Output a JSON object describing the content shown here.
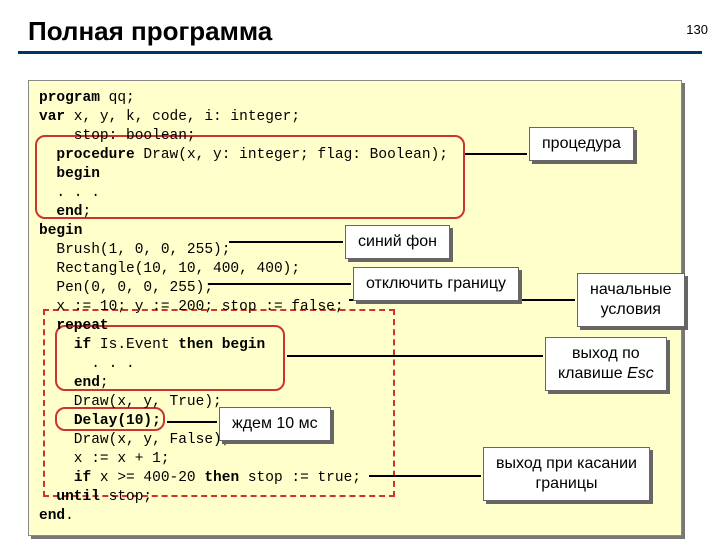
{
  "page_number": "130",
  "title": "Полная программа",
  "code_lines": [
    {
      "t": "program qq;",
      "bold_ranges": [
        [
          0,
          7
        ]
      ]
    },
    {
      "t": "var x, y, k, code, i: integer;",
      "bold_ranges": [
        [
          0,
          3
        ]
      ]
    },
    {
      "t": "    stop: boolean;",
      "bold_ranges": []
    },
    {
      "t": "  procedure Draw(x, y: integer; flag: Boolean);",
      "bold_ranges": [
        [
          2,
          11
        ]
      ]
    },
    {
      "t": "  begin",
      "bold_ranges": [
        [
          2,
          7
        ]
      ]
    },
    {
      "t": "  . . .",
      "bold_ranges": []
    },
    {
      "t": "  end;",
      "bold_ranges": [
        [
          2,
          5
        ]
      ]
    },
    {
      "t": "begin",
      "bold_ranges": [
        [
          0,
          5
        ]
      ]
    },
    {
      "t": "  Brush(1, 0, 0, 255);",
      "bold_ranges": []
    },
    {
      "t": "  Rectangle(10, 10, 400, 400);",
      "bold_ranges": []
    },
    {
      "t": "  Pen(0, 0, 0, 255);",
      "bold_ranges": []
    },
    {
      "t": "  x := 10; y := 200; stop := false;",
      "bold_ranges": []
    },
    {
      "t": "  repeat",
      "bold_ranges": [
        [
          2,
          8
        ]
      ]
    },
    {
      "t": "    if Is.Event then begin",
      "bold_ranges": [
        [
          4,
          6
        ],
        [
          16,
          20
        ],
        [
          21,
          26
        ]
      ]
    },
    {
      "t": "      . . .",
      "bold_ranges": []
    },
    {
      "t": "    end;",
      "bold_ranges": [
        [
          4,
          7
        ]
      ]
    },
    {
      "t": "    Draw(x, y, True);",
      "bold_ranges": []
    },
    {
      "t": "    Delay(10);",
      "bold_ranges": [
        [
          4,
          14
        ]
      ]
    },
    {
      "t": "    Draw(x, y, False);",
      "bold_ranges": []
    },
    {
      "t": "    x := x + 1;",
      "bold_ranges": []
    },
    {
      "t": "    if x >= 400-20 then stop := true;",
      "bold_ranges": [
        [
          4,
          6
        ],
        [
          19,
          23
        ]
      ]
    },
    {
      "t": "  until stop;",
      "bold_ranges": [
        [
          2,
          7
        ]
      ]
    },
    {
      "t": "end.",
      "bold_ranges": [
        [
          0,
          3
        ]
      ]
    }
  ],
  "callouts": {
    "procedure": "процедура",
    "blue_bg": "синий фон",
    "disable_border": "отключить границу",
    "initial_cond_l1": "начальные",
    "initial_cond_l2": "условия",
    "exit_esc_l1": "выход по",
    "exit_esc_l2_a": "клавише ",
    "exit_esc_l2_b": "Esc",
    "wait": "ждем 10 мс",
    "exit_border_l1": "выход при касании",
    "exit_border_l2": "границы"
  }
}
